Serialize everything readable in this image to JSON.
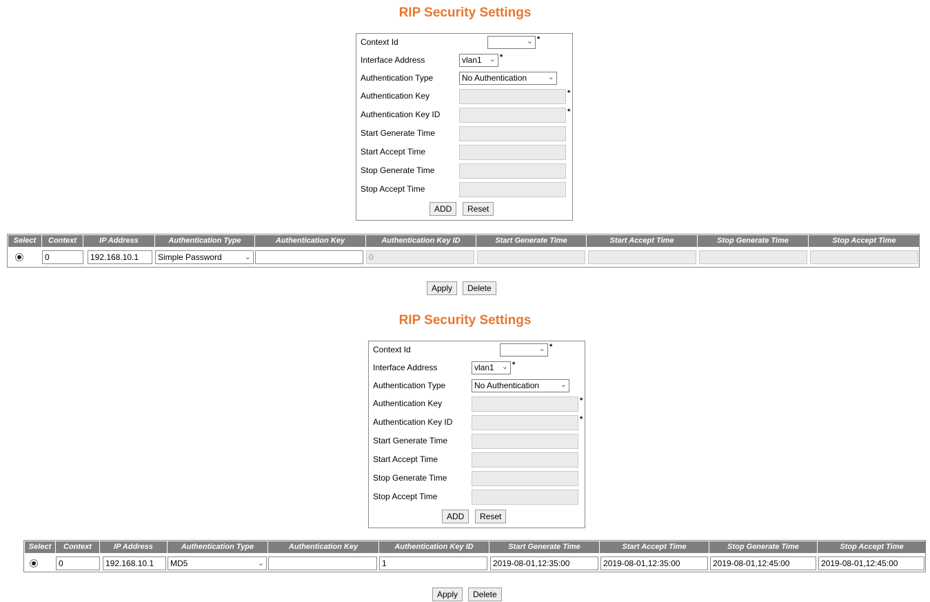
{
  "sections": [
    {
      "title": "RIP Security Settings",
      "form": {
        "context_id_label": "Context Id",
        "context_id_value": "",
        "interface_address_label": "Interface Address",
        "interface_address_value": "vlan1",
        "auth_type_label": "Authentication Type",
        "auth_type_value": "No Authentication",
        "auth_key_label": "Authentication Key",
        "auth_key_id_label": "Authentication Key ID",
        "start_generate_label": "Start Generate Time",
        "start_accept_label": "Start Accept Time",
        "stop_generate_label": "Stop Generate Time",
        "stop_accept_label": "Stop Accept Time",
        "required_mark": "*",
        "add_label": "ADD",
        "reset_label": "Reset"
      },
      "table": {
        "headers": [
          "Select",
          "Context",
          "IP Address",
          "Authentication Type",
          "Authentication Key",
          "Authentication Key ID",
          "Start Generate Time",
          "Start Accept Time",
          "Stop Generate Time",
          "Stop Accept Time"
        ],
        "row": {
          "context": "0",
          "ip_address": "192.168.10.1",
          "auth_type": "Simple Password",
          "auth_key": "",
          "auth_key_id": "0",
          "start_generate": "",
          "start_accept": "",
          "stop_generate": "",
          "stop_accept": ""
        }
      },
      "apply_label": "Apply",
      "delete_label": "Delete"
    },
    {
      "title": "RIP Security Settings",
      "form": {
        "context_id_label": "Context Id",
        "context_id_value": "",
        "interface_address_label": "Interface Address",
        "interface_address_value": "vlan1",
        "auth_type_label": "Authentication Type",
        "auth_type_value": "No Authentication",
        "auth_key_label": "Authentication Key",
        "auth_key_id_label": "Authentication Key ID",
        "start_generate_label": "Start Generate Time",
        "start_accept_label": "Start Accept Time",
        "stop_generate_label": "Stop Generate Time",
        "stop_accept_label": "Stop Accept Time",
        "required_mark": "*",
        "add_label": "ADD",
        "reset_label": "Reset"
      },
      "table": {
        "headers": [
          "Select",
          "Context",
          "IP Address",
          "Authentication Type",
          "Authentication Key",
          "Authentication Key ID",
          "Start Generate Time",
          "Start Accept Time",
          "Stop Generate Time",
          "Stop Accept Time"
        ],
        "row": {
          "context": "0",
          "ip_address": "192.168.10.1",
          "auth_type": "MD5",
          "auth_key": "",
          "auth_key_id": "1",
          "start_generate": "2019-08-01,12:35:00",
          "start_accept": "2019-08-01,12:35:00",
          "stop_generate": "2019-08-01,12:45:00",
          "stop_accept": "2019-08-01,12:45:00"
        }
      },
      "apply_label": "Apply",
      "delete_label": "Delete"
    }
  ]
}
